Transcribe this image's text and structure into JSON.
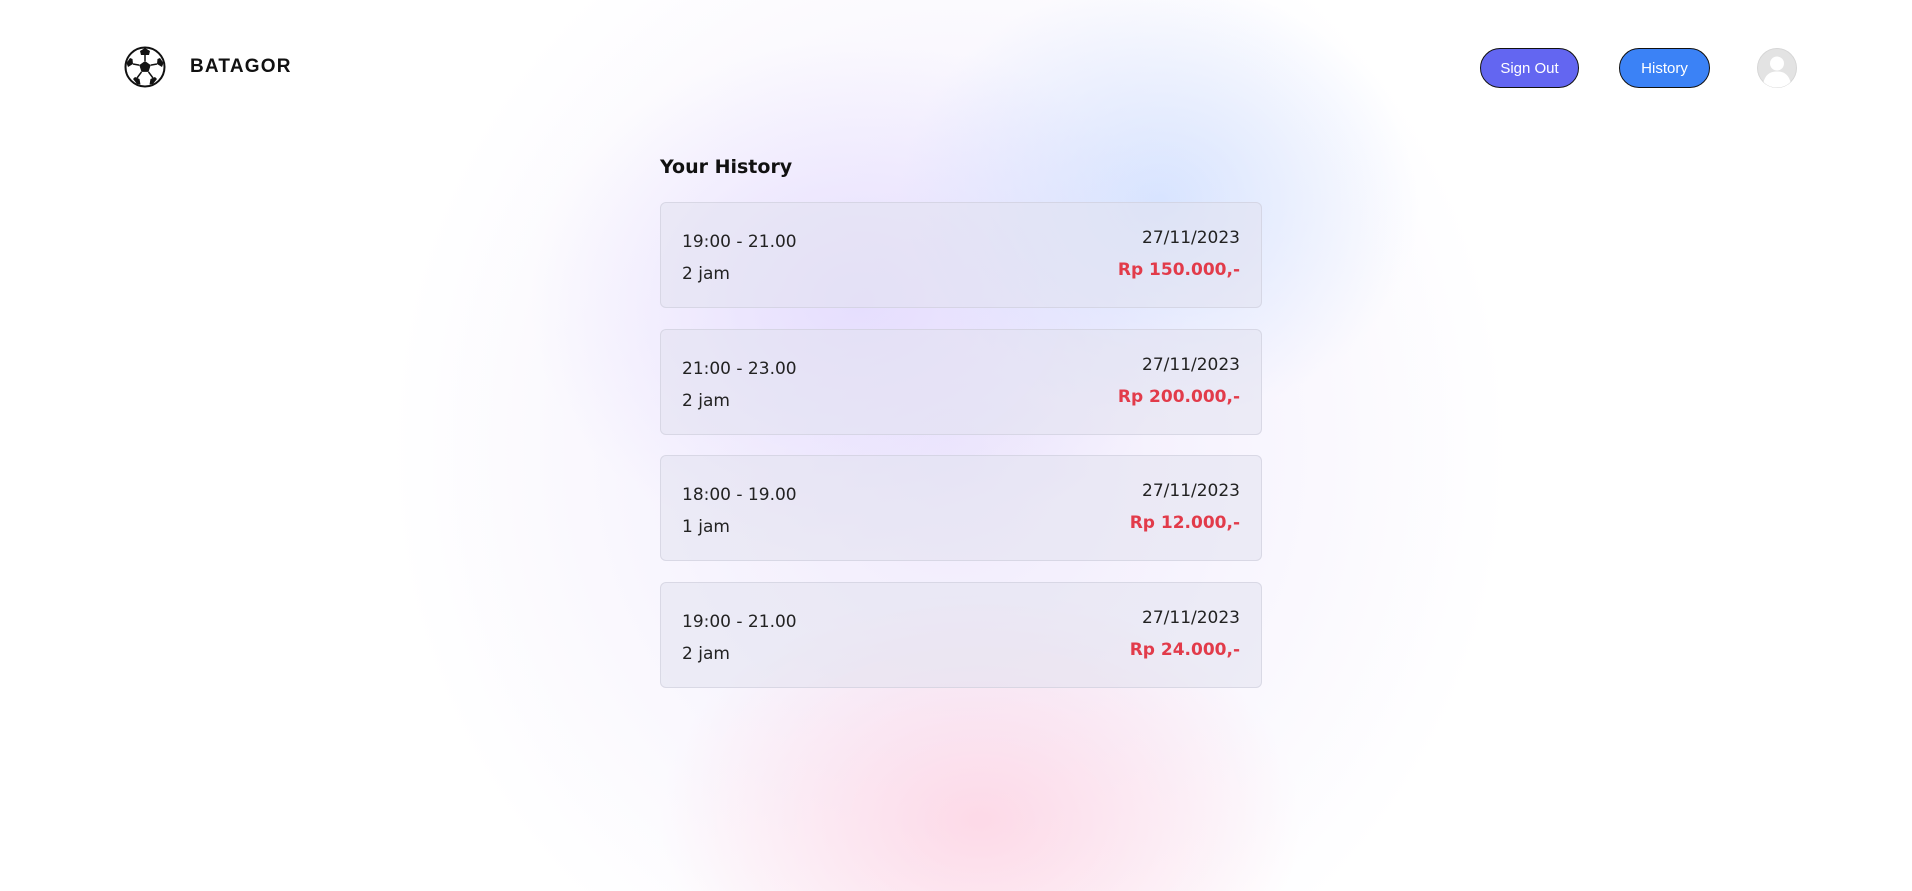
{
  "header": {
    "brand": "BATAGOR",
    "logo_icon": "soccer-ball-icon",
    "signout_label": "Sign Out",
    "history_label": "History",
    "avatar_icon": "user-avatar-icon",
    "colors": {
      "signout_bg": "#6366f1",
      "history_bg": "#3b82f6"
    }
  },
  "main": {
    "title": "Your History",
    "price_color": "#e23b4a",
    "items": [
      {
        "time": "19:00 - 21.00",
        "duration": "2 jam",
        "date": "27/11/2023",
        "price": "Rp 150.000,-"
      },
      {
        "time": "21:00 - 23.00",
        "duration": "2 jam",
        "date": "27/11/2023",
        "price": "Rp 200.000,-"
      },
      {
        "time": "18:00 - 19.00",
        "duration": "1 jam",
        "date": "27/11/2023",
        "price": "Rp 12.000,-"
      },
      {
        "time": "19:00 - 21.00",
        "duration": "2 jam",
        "date": "27/11/2023",
        "price": "Rp 24.000,-"
      }
    ]
  }
}
